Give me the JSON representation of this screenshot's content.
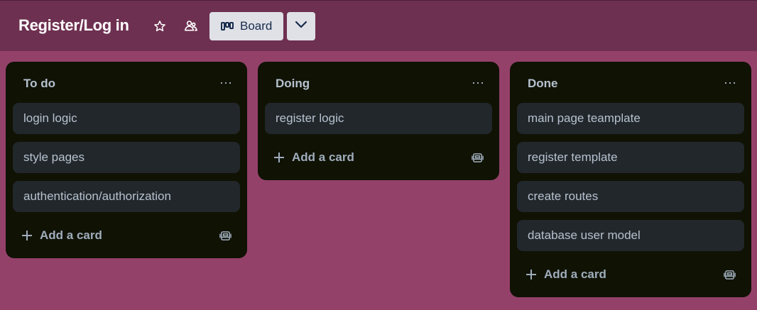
{
  "header": {
    "title": "Register/Log in",
    "star_icon": "star-icon",
    "visibility_icon": "workspace-visible-icon",
    "view_button_label": "Board",
    "view_button_icon": "board-icon",
    "view_dropdown_icon": "chevron-down-icon"
  },
  "colors": {
    "background": "#94416a",
    "header": "#6e3050",
    "list": "#101204",
    "card": "#22272b",
    "text": "#b6c2cf"
  },
  "lists": [
    {
      "title": "To do",
      "menu": "···",
      "cards": [
        "login logic",
        "style pages",
        "authentication/authorization"
      ],
      "add_label": "Add a card"
    },
    {
      "title": "Doing",
      "menu": "···",
      "cards": [
        "register logic"
      ],
      "add_label": "Add a card"
    },
    {
      "title": "Done",
      "menu": "···",
      "cards": [
        "main page teamplate",
        "register template",
        "create routes",
        "database user model"
      ],
      "add_label": "Add a card"
    }
  ]
}
